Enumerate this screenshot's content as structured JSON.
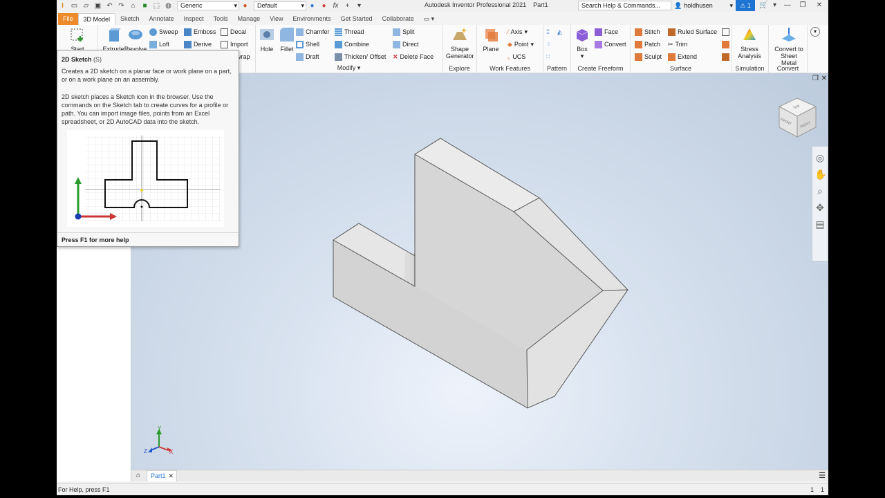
{
  "titlebar": {
    "app_title": "Autodesk Inventor Professional 2021",
    "doc_name": "Part1",
    "material": "Generic",
    "appearance": "Default",
    "search_placeholder": "Search Help & Commands...",
    "user": "holdhusen",
    "alert_count": "1"
  },
  "tabs": [
    "File",
    "3D Model",
    "Sketch",
    "Annotate",
    "Inspect",
    "Tools",
    "Manage",
    "View",
    "Environments",
    "Get Started",
    "Collaborate"
  ],
  "active_tab": "3D Model",
  "ribbon": {
    "sketch": {
      "start": "Start"
    },
    "create": {
      "extrude": "Extrude",
      "revolve": "Revolve",
      "sweep": "Sweep",
      "loft": "Loft",
      "emboss": "Emboss",
      "derive": "Derive",
      "decal": "Decal",
      "import": "Import",
      "unwrap": "wrap"
    },
    "modify": {
      "label": "Modify ▾",
      "hole": "Hole",
      "fillet": "Fillet",
      "chamfer": "Chamfer",
      "shell": "Shell",
      "draft": "Draft",
      "thread": "Thread",
      "combine": "Combine",
      "thicken": "Thicken/ Offset",
      "split": "Split",
      "direct": "Direct",
      "delete_face": "Delete Face"
    },
    "explore": {
      "label": "Explore",
      "shape_gen_1": "Shape",
      "shape_gen_2": "Generator"
    },
    "work": {
      "label": "Work Features",
      "plane": "Plane",
      "axis": "Axis",
      "point": "Point",
      "ucs": "UCS"
    },
    "pattern": {
      "label": "Pattern"
    },
    "freeform": {
      "label": "Create Freeform",
      "box": "Box",
      "face": "Face",
      "convert": "Convert"
    },
    "surface": {
      "label": "Surface",
      "stitch": "Stitch",
      "patch": "Patch",
      "sculpt": "Sculpt",
      "ruled": "Ruled Surface",
      "trim": "Trim",
      "extend": "Extend"
    },
    "simulation": {
      "label": "Simulation",
      "stress_1": "Stress",
      "stress_2": "Analysis"
    },
    "convert": {
      "label": "Convert",
      "sheet_1": "Convert to",
      "sheet_2": "Sheet Metal"
    }
  },
  "tooltip": {
    "title": "2D Sketch",
    "shortcut": "(S)",
    "p1": "Creates a 2D sketch on a planar face or work plane on a part, or on a work plane on an assembly.",
    "p2": "2D sketch places a Sketch icon in the browser. Use the commands on the Sketch tab to create curves for a profile or path. You can import image files, points from an Excel spreadsheet, or 2D AutoCAD data into the sketch.",
    "footer": "Press F1 for more help"
  },
  "viewcube": {
    "top": "TOP",
    "front": "FRONT",
    "right": "RIGHT"
  },
  "triad": {
    "x": "X",
    "y": "Y",
    "z": "Z"
  },
  "doc_tabs": {
    "part": "Part1"
  },
  "status": {
    "help": "For Help, press F1",
    "num1": "1",
    "num2": "1"
  }
}
